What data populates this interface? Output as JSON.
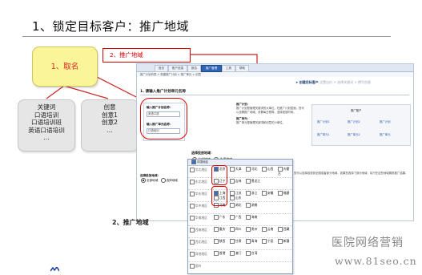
{
  "slide": {
    "title": "1、锁定目标客户：推广地域",
    "yellow_box_label": "1、取名",
    "tag_label": "2、推广地域",
    "bottom_label": "2、推广地域",
    "keywords_box": {
      "lines": [
        "关键词",
        "口语培训",
        "口语培训班",
        "英语口语培训",
        "..."
      ]
    },
    "ideas_box": {
      "lines": [
        "创意",
        "创意1",
        "创意2",
        "..."
      ]
    },
    "watermark_cn": "医院网络营销",
    "watermark_url": "www.81seo.cn"
  },
  "app": {
    "nav_tabs": [
      "首页",
      "账户信息",
      "报告",
      "推广管理",
      "工具",
      "帮助"
    ],
    "active_tab_index": 3,
    "subbar": "推广计划列表 > 新建推广计划 > 推广单元 > 创意",
    "step_current": "创建目标客户",
    "step_rest": "设置出价 > 选择关键词 > 撰写创意",
    "section_title": "1. 请输入推广计划单元名称",
    "form": {
      "plan_label": "输入推广计划名称：",
      "plan_value": "英语口语",
      "unit_label": "输入推广单元名称：",
      "unit_value": "口语培训"
    },
    "info_title": "推广计划：",
    "info_text": "推广计划是管理关键词的大单位，在推广计划层面，您可以设置推广地域，设置每日预算，选择投放时间。",
    "info_title2": "推广单元：",
    "info_text2": "推广单元是管理关键词和创意的小单位。",
    "diagram_head": "推广账户",
    "diagram_cells": [
      "推广计划1",
      "推广计划2",
      "推广计划",
      "推广单元1",
      "推广单元2",
      "推广单元"
    ],
    "radio_question": "选择投放地域：",
    "radio_all": "全部地域",
    "radio_select": "选择地域",
    "budget_label": "选择投放地域：",
    "budget_options": [
      "全部地域",
      "选择地域"
    ],
    "side_note": "您可以选择投放到全国或者部分地域，如果您选择了部分地域，将只在这些地域展现推广结果。"
  },
  "region_panel": {
    "header": "中国地区",
    "rows": [
      {
        "group": "华北地区",
        "items": [
          "北京",
          "天津",
          "河北",
          "山西",
          "内蒙古"
        ],
        "checked": [
          0
        ]
      },
      {
        "group": "东北地区",
        "items": [
          "辽宁",
          "吉林",
          "黑龙江"
        ],
        "checked": []
      },
      {
        "group": "华东地区",
        "items": [
          "上海",
          "江苏",
          "浙江",
          "安徽",
          "福建",
          "江西",
          "山东"
        ],
        "checked": [
          0
        ]
      },
      {
        "group": "华中地区",
        "items": [
          "河南",
          "湖北",
          "湖南"
        ],
        "checked": []
      },
      {
        "group": "华南地区",
        "items": [
          "广东",
          "广西",
          "海南"
        ],
        "checked": []
      },
      {
        "group": "西南地区",
        "items": [
          "重庆",
          "四川",
          "贵州",
          "云南",
          "西藏"
        ],
        "checked": []
      },
      {
        "group": "西北地区",
        "items": [
          "陕西",
          "甘肃",
          "青海",
          "宁夏",
          "新疆"
        ],
        "checked": []
      },
      {
        "group": "其他地区",
        "items": [
          "香港",
          "澳门",
          "台湾"
        ],
        "checked": []
      }
    ],
    "footer": "国外"
  }
}
